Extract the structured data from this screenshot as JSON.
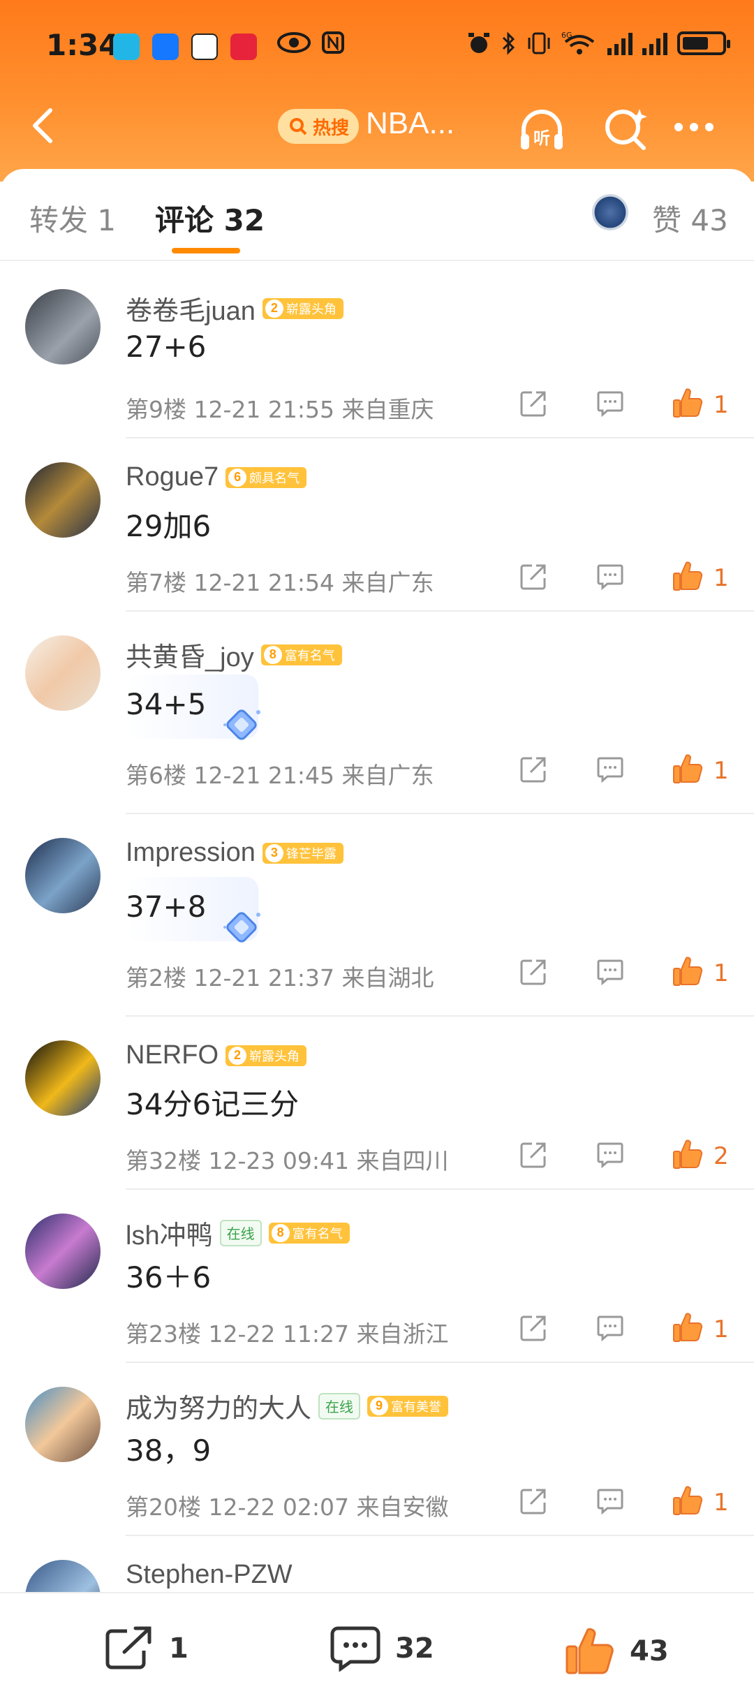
{
  "status_bar": {
    "time": "1:34",
    "signal_label": "6G"
  },
  "nav": {
    "hot_label": "热搜",
    "title": "NBA...",
    "listen_label": "听"
  },
  "tabs": {
    "repost": "转发 1",
    "comments": "评论 32",
    "likes": "赞 43"
  },
  "comments": [
    {
      "user": "卷卷毛juan",
      "badge_level": "2",
      "badge": "崭露头角",
      "online": "",
      "text": "27+6",
      "floor": "第9楼",
      "time": "12-21 21:55",
      "region": "来自重庆",
      "likes": "1"
    },
    {
      "user": "Rogue7",
      "badge_level": "6",
      "badge": "颇具名气",
      "online": "",
      "text": "29加6",
      "floor": "第7楼",
      "time": "12-21 21:54",
      "region": "来自广东",
      "likes": "1"
    },
    {
      "user": "共黄昏_joy",
      "badge_level": "8",
      "badge": "富有名气",
      "online": "",
      "text": "34+5",
      "floor": "第6楼",
      "time": "12-21 21:45",
      "region": "来自广东",
      "likes": "1"
    },
    {
      "user": "Impression",
      "badge_level": "3",
      "badge": "锋芒毕露",
      "online": "",
      "text": "37+8",
      "floor": "第2楼",
      "time": "12-21 21:37",
      "region": "来自湖北",
      "likes": "1"
    },
    {
      "user": "NERFO",
      "badge_level": "2",
      "badge": "崭露头角",
      "online": "",
      "text": "34分6记三分",
      "floor": "第32楼",
      "time": "12-23 09:41",
      "region": "来自四川",
      "likes": "2"
    },
    {
      "user": "lsh冲鸭",
      "badge_level": "8",
      "badge": "富有名气",
      "online": "在线",
      "text": "36＋6",
      "floor": "第23楼",
      "time": "12-22 11:27",
      "region": "来自浙江",
      "likes": "1"
    },
    {
      "user": "成为努力的大人",
      "badge_level": "9",
      "badge": "富有美誉",
      "online": "在线",
      "text": "38，9",
      "floor": "第20楼",
      "time": "12-22 02:07",
      "region": "来自安徽",
      "likes": "1"
    },
    {
      "user": "Stephen-PZW",
      "badge_level": "",
      "badge": "",
      "online": "",
      "text": "",
      "floor": "",
      "time": "",
      "region": "",
      "likes": ""
    }
  ],
  "bottom_bar": {
    "repost_count": "1",
    "comment_count": "32",
    "like_count": "43"
  },
  "colors": {
    "header_orange": "#ff7a1a",
    "like_orange": "#e8732a",
    "tab_underline": "#ff8a00",
    "badge_gold": "#ffc23a",
    "online_green": "#3aa34a"
  }
}
